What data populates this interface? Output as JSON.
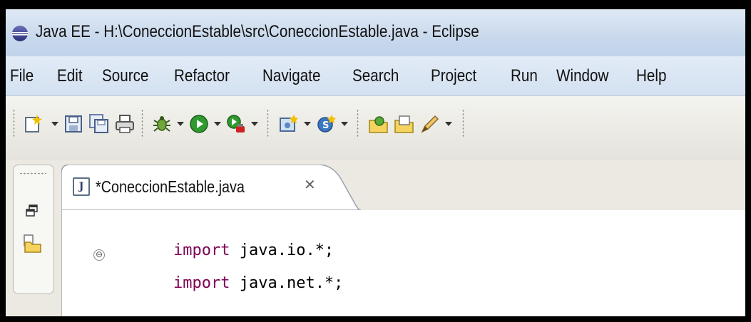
{
  "window": {
    "title": "Java EE - H:\\ConeccionEstable\\src\\ConeccionEstable.java - Eclipse",
    "icon": "eclipse-icon"
  },
  "menu": [
    "File",
    "Edit",
    "Source",
    "Refactor",
    "Navigate",
    "Search",
    "Project",
    "Run",
    "Window",
    "Help"
  ],
  "toolbar": {
    "icons": [
      "new-wizard-icon",
      "save-icon",
      "save-all-icon",
      "print-icon",
      "debug-icon",
      "run-icon",
      "external-tools-icon",
      "new-java-project-icon",
      "new-java-class-icon",
      "open-type-icon",
      "open-task-icon",
      "pen-icon"
    ]
  },
  "left_trim": {
    "icons": [
      "restore-icon",
      "package-explorer-icon"
    ]
  },
  "editor": {
    "tab": {
      "icon_letter": "J",
      "label": "*ConeccionEstable.java",
      "close_glyph": "✕"
    },
    "fold_glyph": "⊖",
    "lines": [
      {
        "keyword": "import",
        "rest": " java.io.*;"
      },
      {
        "keyword": "import",
        "rest": " java.net.*;"
      }
    ]
  },
  "colors": {
    "keyword": "#7f0055",
    "titlebar": "#c9d9ec"
  }
}
